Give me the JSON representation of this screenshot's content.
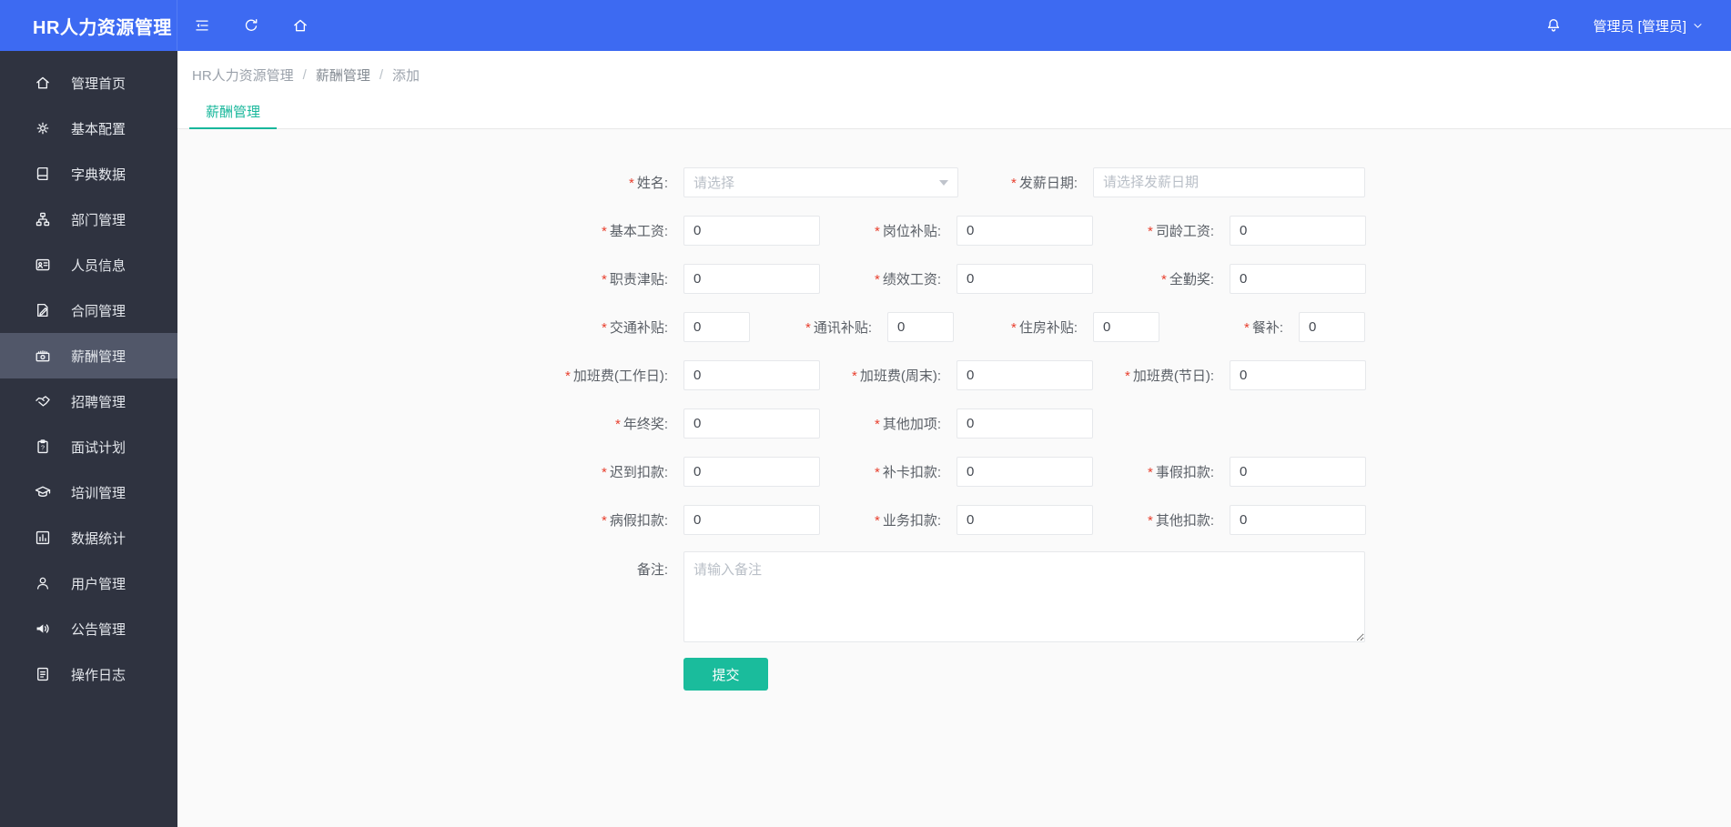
{
  "topbar": {
    "title": "HR人力资源管理",
    "icons": [
      {
        "name": "menu-fold-icon"
      },
      {
        "name": "refresh-icon"
      },
      {
        "name": "home-icon"
      }
    ],
    "bell_icon": "bell-icon",
    "user": {
      "label": "管理员 [管理员]",
      "chevron_icon": "chevron-down-icon"
    }
  },
  "sidebar": {
    "items": [
      {
        "icon": "home-icon",
        "label": "管理首页",
        "active": false
      },
      {
        "icon": "gear-icon",
        "label": "基本配置",
        "active": false
      },
      {
        "icon": "book-icon",
        "label": "字典数据",
        "active": false
      },
      {
        "icon": "org-chart-icon",
        "label": "部门管理",
        "active": false
      },
      {
        "icon": "id-card-icon",
        "label": "人员信息",
        "active": false
      },
      {
        "icon": "contract-icon",
        "label": "合同管理",
        "active": false
      },
      {
        "icon": "money-icon",
        "label": "薪酬管理",
        "active": true
      },
      {
        "icon": "handshake-icon",
        "label": "招聘管理",
        "active": false
      },
      {
        "icon": "interview-icon",
        "label": "面试计划",
        "active": false
      },
      {
        "icon": "training-icon",
        "label": "培训管理",
        "active": false
      },
      {
        "icon": "chart-icon",
        "label": "数据统计",
        "active": false
      },
      {
        "icon": "user-icon",
        "label": "用户管理",
        "active": false
      },
      {
        "icon": "announcement-icon",
        "label": "公告管理",
        "active": false
      },
      {
        "icon": "log-icon",
        "label": "操作日志",
        "active": false
      }
    ]
  },
  "breadcrumb": {
    "items": [
      "HR人力资源管理",
      "薪酬管理",
      "添加"
    ],
    "separator": "/"
  },
  "tab": {
    "label": "薪酬管理"
  },
  "form": {
    "label_suffix": ":",
    "required_mark": "*",
    "rows": [
      {
        "type": "wide",
        "fields": [
          {
            "label": "姓名",
            "required": true,
            "control": "select",
            "placeholder": "请选择"
          },
          {
            "label": "发薪日期",
            "required": true,
            "control": "text",
            "placeholder": "请选择发薪日期",
            "value": ""
          }
        ]
      },
      {
        "type": "cols3",
        "fields": [
          {
            "label": "基本工资",
            "required": true,
            "control": "number",
            "value": "0"
          },
          {
            "label": "岗位补贴",
            "required": true,
            "control": "number",
            "value": "0"
          },
          {
            "label": "司龄工资",
            "required": true,
            "control": "number",
            "value": "0"
          }
        ]
      },
      {
        "type": "cols3",
        "fields": [
          {
            "label": "职责津贴",
            "required": true,
            "control": "number",
            "value": "0"
          },
          {
            "label": "绩效工资",
            "required": true,
            "control": "number",
            "value": "0"
          },
          {
            "label": "全勤奖",
            "required": true,
            "control": "number",
            "value": "0"
          }
        ]
      },
      {
        "type": "cols4",
        "fields": [
          {
            "label": "交通补贴",
            "required": true,
            "control": "number",
            "value": "0"
          },
          {
            "label": "通讯补贴",
            "required": true,
            "control": "number",
            "value": "0"
          },
          {
            "label": "住房补贴",
            "required": true,
            "control": "number",
            "value": "0"
          },
          {
            "label": "餐补",
            "required": true,
            "control": "number",
            "value": "0"
          }
        ]
      },
      {
        "type": "cols3",
        "fields": [
          {
            "label": "加班费(工作日)",
            "required": true,
            "control": "number",
            "value": "0"
          },
          {
            "label": "加班费(周末)",
            "required": true,
            "control": "number",
            "value": "0"
          },
          {
            "label": "加班费(节日)",
            "required": true,
            "control": "number",
            "value": "0"
          }
        ]
      },
      {
        "type": "cols3",
        "fields": [
          {
            "label": "年终奖",
            "required": true,
            "control": "number",
            "value": "0"
          },
          {
            "label": "其他加项",
            "required": true,
            "control": "number",
            "value": "0"
          }
        ]
      },
      {
        "type": "cols3",
        "fields": [
          {
            "label": "迟到扣款",
            "required": true,
            "control": "number",
            "value": "0"
          },
          {
            "label": "补卡扣款",
            "required": true,
            "control": "number",
            "value": "0"
          },
          {
            "label": "事假扣款",
            "required": true,
            "control": "number",
            "value": "0"
          }
        ]
      },
      {
        "type": "cols3",
        "fields": [
          {
            "label": "病假扣款",
            "required": true,
            "control": "number",
            "value": "0"
          },
          {
            "label": "业务扣款",
            "required": true,
            "control": "number",
            "value": "0"
          },
          {
            "label": "其他扣款",
            "required": true,
            "control": "number",
            "value": "0"
          }
        ]
      }
    ],
    "remark": {
      "label": "备注",
      "required": false,
      "placeholder": "请输入备注",
      "value": ""
    },
    "submit_label": "提交"
  },
  "colors": {
    "topbar_blue": "#3d6af2",
    "sidebar_dark": "#2f3340",
    "sidebar_active": "#515769",
    "tab_accent": "#18b79b",
    "submit_teal": "#1abc9c",
    "required_red": "#e8402f"
  }
}
